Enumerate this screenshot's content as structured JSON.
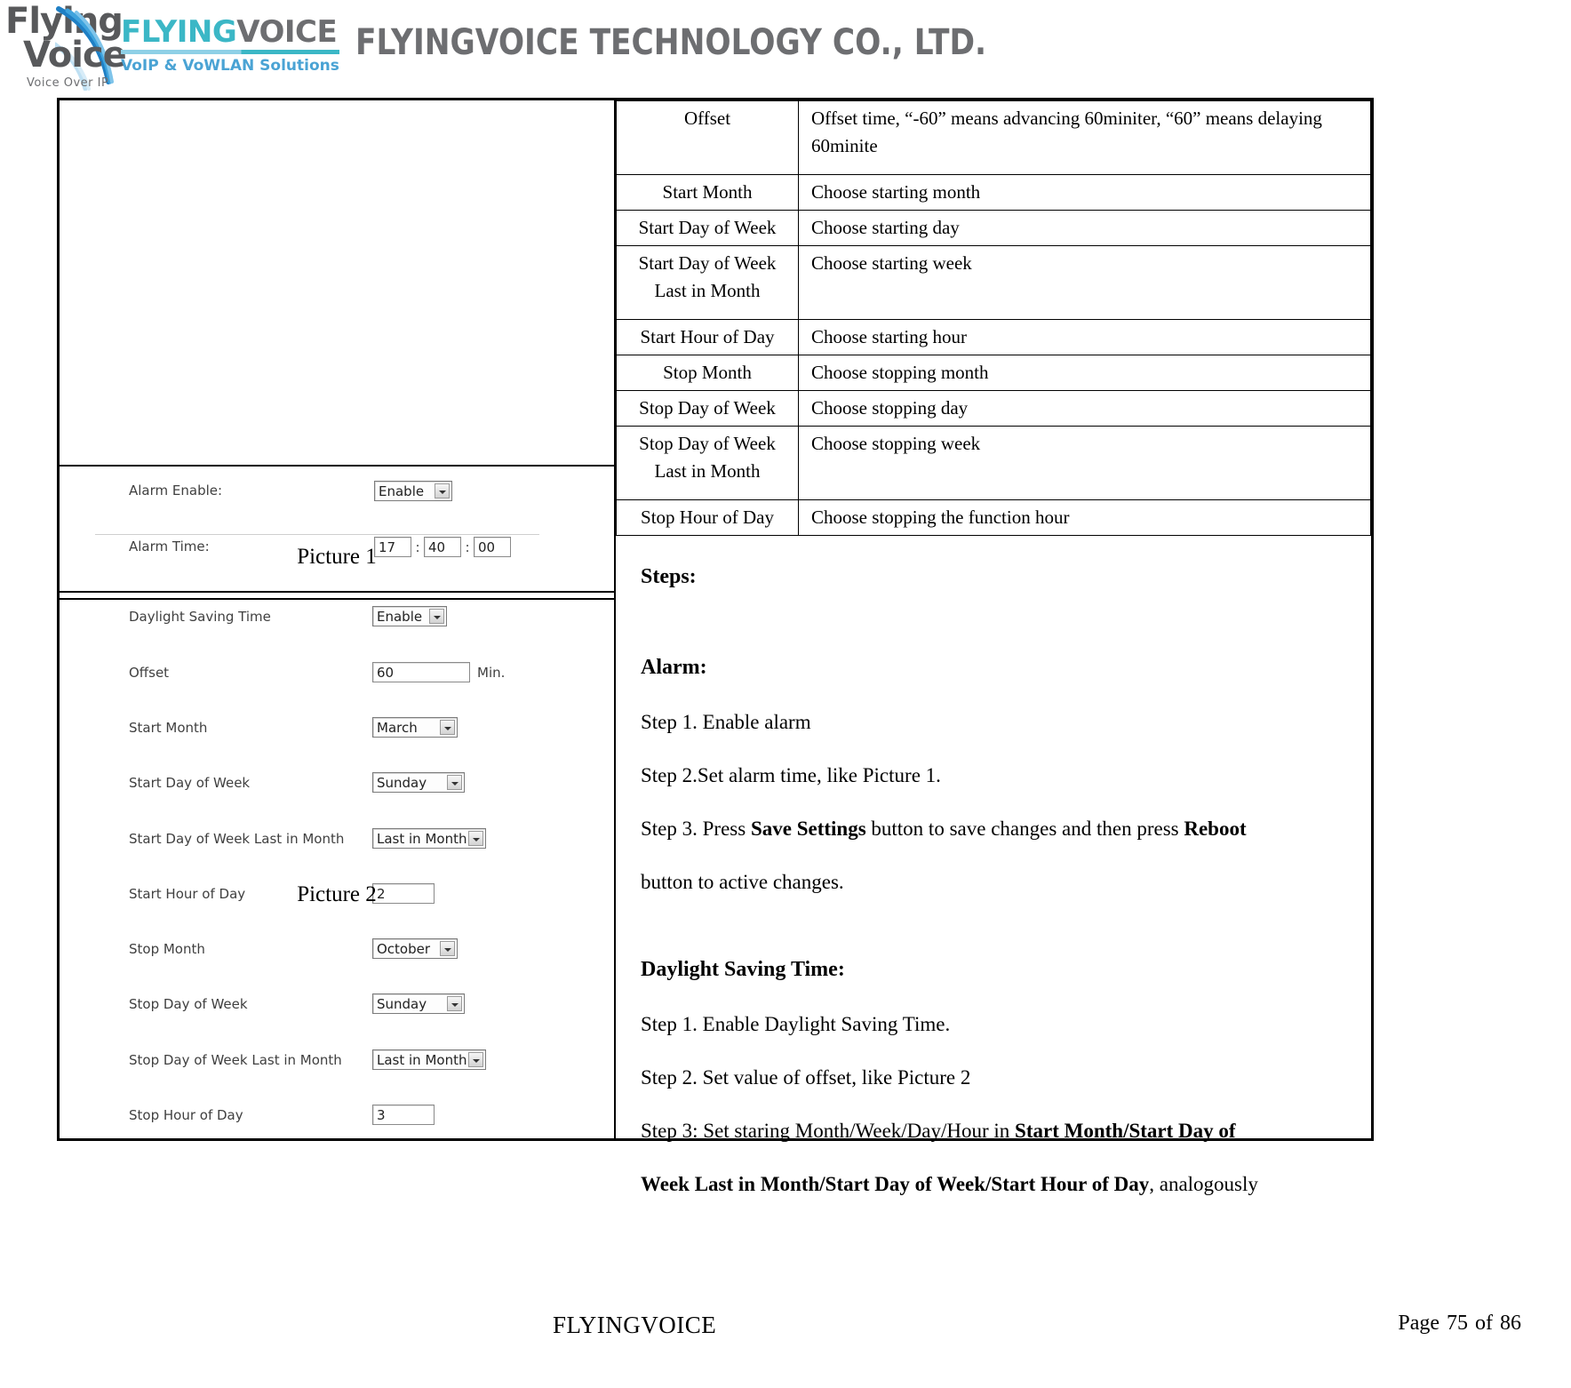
{
  "header": {
    "logo_mark": {
      "line1": "Flying",
      "line2": "Voice",
      "tagline": "Voice Over IP"
    },
    "logo_word": {
      "part_cyan": "FLYING",
      "part_grey": "VOICE",
      "subtitle": "VoIP & VoWLAN Solutions"
    },
    "company_title": "FLYINGVOICE TECHNOLOGY CO., LTD.",
    "colors": {
      "cyan": "#3bb7c6",
      "grey": "#6d6e71",
      "light_blue": "#4aa3d4"
    }
  },
  "param_table": {
    "rows": [
      {
        "key": "Offset",
        "key_line2": "",
        "value": "Offset time, “-60” means advancing 60miniter, “60” means delaying 60minite",
        "tall": true
      },
      {
        "key": "Start Month",
        "key_line2": "",
        "value": "Choose starting month",
        "tall": false
      },
      {
        "key": "Start Day of Week",
        "key_line2": "",
        "value": "Choose starting day",
        "tall": false
      },
      {
        "key": "Start Day of Week",
        "key_line2": "Last in Month",
        "value": "Choose starting week",
        "tall": true
      },
      {
        "key": "Start Hour of Day",
        "key_line2": "",
        "value": "Choose starting hour",
        "tall": false
      },
      {
        "key": "Stop Month",
        "key_line2": "",
        "value": "Choose stopping month",
        "tall": false
      },
      {
        "key": "Stop Day of Week",
        "key_line2": "",
        "value": "Choose stopping day",
        "tall": false
      },
      {
        "key": "Stop Day of Week",
        "key_line2": "Last in Month",
        "value": "Choose stopping week",
        "tall": true
      },
      {
        "key": "Stop Hour of Day",
        "key_line2": "",
        "value": "Choose stopping the function hour",
        "tall": false
      }
    ]
  },
  "steps": {
    "heading": "Steps:",
    "alarm": {
      "title": "Alarm:",
      "step1": "Step 1. Enable alarm",
      "step2": "Step 2.Set alarm time, like Picture 1.",
      "step3_a": "Step 3. Press ",
      "step3_b": "Save Settings",
      "step3_c": " button to save changes and then press ",
      "step3_d": "Reboot",
      "step3_e": "button to active changes."
    },
    "dst": {
      "title": "Daylight Saving Time:",
      "step1": "Step 1. Enable Daylight Saving Time.",
      "step2": "Step 2. Set value of offset, like Picture 2",
      "step3_a": "Step 3: Set staring Month/Week/Day/Hour in ",
      "step3_b": "Start Month/Start Day of",
      "step3_c": "Week Last in Month/Start Day of Week/Start Hour of Day",
      "step3_d": ", analogously"
    }
  },
  "picture1": {
    "caption": "Picture 1",
    "rows": [
      {
        "label": "Alarm Enable:",
        "type": "select",
        "value": "Enable"
      },
      {
        "label": "Alarm Time:",
        "type": "time",
        "hour": "17",
        "minute": "40",
        "second": "00",
        "sep": ":"
      }
    ]
  },
  "picture2": {
    "caption": "Picture 2",
    "rows": [
      {
        "label": "Daylight Saving Time",
        "type": "select",
        "value": "Enable"
      },
      {
        "label": "Offset",
        "type": "text",
        "value": "60",
        "unit": "Min."
      },
      {
        "label": "Start Month",
        "type": "select",
        "value": "March"
      },
      {
        "label": "Start Day of Week",
        "type": "select",
        "value": "Sunday"
      },
      {
        "label": "Start Day of Week Last in Month",
        "type": "select",
        "value": "Last in Month"
      },
      {
        "label": "Start Hour of Day",
        "type": "text",
        "value": "2",
        "unit": ""
      },
      {
        "label": "Stop Month",
        "type": "select",
        "value": "October"
      },
      {
        "label": "Stop Day of Week",
        "type": "select",
        "value": "Sunday"
      },
      {
        "label": "Stop Day of Week Last in Month",
        "type": "select",
        "value": "Last in Month"
      },
      {
        "label": "Stop Hour of Day",
        "type": "text",
        "value": "3",
        "unit": ""
      }
    ]
  },
  "footer": {
    "brand": "FLYINGVOICE",
    "page_word": "Page",
    "page_number": "75",
    "of_word": "of",
    "page_total": "86"
  }
}
